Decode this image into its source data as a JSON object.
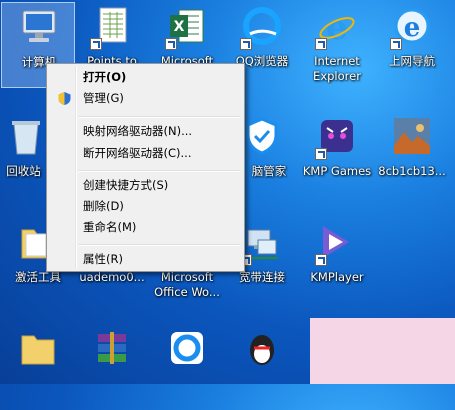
{
  "desktop": {
    "icons": [
      {
        "label": "计算机"
      },
      {
        "label": "Points to"
      },
      {
        "label": "Microsoft"
      },
      {
        "label": "QQ浏览器"
      },
      {
        "label": "Internet Explorer"
      },
      {
        "label": "上网导航"
      },
      {
        "label": "回收站"
      },
      {
        "label": "脑管家"
      },
      {
        "label": "KMP Games"
      },
      {
        "label": "8cb1cb13..."
      },
      {
        "label": "激活工具"
      },
      {
        "label": "uademo0..."
      },
      {
        "label": "Microsoft Office Wo..."
      },
      {
        "label": "宽带连接"
      },
      {
        "label": "KMPlayer"
      }
    ]
  },
  "context_menu": {
    "items": [
      {
        "label": "打开(O)",
        "bold": true
      },
      {
        "label": "管理(G)"
      },
      {
        "label": "映射网络驱动器(N)..."
      },
      {
        "label": "断开网络驱动器(C)..."
      },
      {
        "label": "创建快捷方式(S)"
      },
      {
        "label": "删除(D)"
      },
      {
        "label": "重命名(M)"
      },
      {
        "label": "属性(R)"
      }
    ]
  }
}
